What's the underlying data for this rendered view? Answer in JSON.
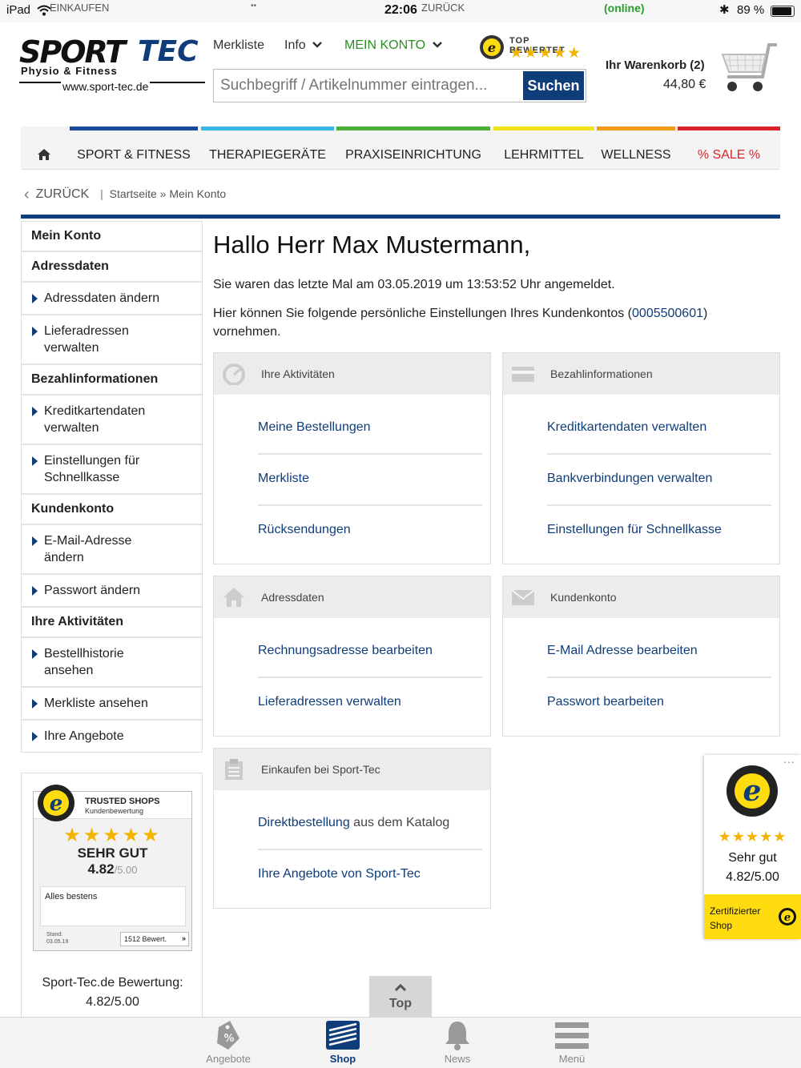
{
  "statusbar": {
    "device": "iPad",
    "back_app": "EINKAUFEN",
    "dots": "••",
    "time": "22:06",
    "back_label": "ZURÜCK",
    "online": "(online)",
    "battery": "89 %"
  },
  "header": {
    "logo_line1": "SPORT",
    "logo_line1b": "TEC",
    "logo_sub": "Physio & Fitness",
    "logo_url": "www.sport-tec.de",
    "merkliste": "Merkliste",
    "info": "Info",
    "mein_konto": "MEIN KONTO",
    "top_bewertet": "TOP BEWERTET",
    "search_placeholder": "Suchbegriff / Artikelnummer eintragen...",
    "search_button": "Suchen",
    "cart_label": "Ihr Warenkorb (2)",
    "cart_total": "44,80 €"
  },
  "nav": {
    "items": [
      {
        "label": "SPORT & FITNESS",
        "color": "#1a4a9c"
      },
      {
        "label": "THERAPIEGERÄTE",
        "color": "#39b6e6"
      },
      {
        "label": "PRAXISEINRICHTUNG",
        "color": "#4caf37"
      },
      {
        "label": "LEHRMITTEL",
        "color": "#f2e21a"
      },
      {
        "label": "WELLNESS",
        "color": "#f39a16"
      },
      {
        "label": "% SALE %",
        "color": "#d9232a"
      }
    ]
  },
  "breadcrumb": {
    "back": "ZURÜCK",
    "path": "Startseite » Mein Konto"
  },
  "sidebar": {
    "title": "Mein Konto",
    "sections": [
      {
        "head": "Adressdaten",
        "items": [
          "Adressdaten ändern",
          "Lieferadressen verwalten"
        ]
      },
      {
        "head": "Bezahlinformationen",
        "items": [
          "Kreditkartendaten verwalten",
          "Einstellungen für Schnellkasse"
        ]
      },
      {
        "head": "Kundenkonto",
        "items": [
          "E-Mail-Adresse ändern",
          "Passwort ändern"
        ]
      },
      {
        "head": "Ihre Aktivitäten",
        "items": [
          "Bestellhistorie ansehen",
          "Merkliste ansehen",
          "Ihre Angebote"
        ]
      }
    ]
  },
  "trusted_left": {
    "brand": "TRUSTED SHOPS",
    "sub": "Kundenbewertung",
    "stars": "★★★★★",
    "rating_text": "SEHR GUT",
    "score": "4.82",
    "score_max": "/5.00",
    "comment": "Alles bestens",
    "stand_label": "Stand:",
    "stand_date": "03.05.19",
    "count": "1512 Bewert.",
    "bewertung_line1": "Sport-Tec.de Bewertung:",
    "bewertung_line2": "4.82/5.00"
  },
  "main": {
    "greeting": "Hallo Herr Max Mustermann,",
    "last_login": "Sie waren das letzte Mal am 03.05.2019 um 13:53:52 Uhr angemeldet.",
    "intro_a": "Hier können Sie folgende persönliche Einstellungen Ihres Kundenkontos (",
    "account_no": "0005500601",
    "intro_b": ")",
    "intro_c": "vornehmen."
  },
  "cards": {
    "activities": {
      "title": "Ihre Aktivitäten",
      "links": [
        "Meine Bestellungen",
        "Merkliste",
        "Rücksendungen"
      ]
    },
    "payment": {
      "title": "Bezahlinformationen",
      "links": [
        "Kreditkartendaten verwalten",
        "Bankverbindungen verwalten",
        "Einstellungen für Schnellkasse"
      ]
    },
    "address": {
      "title": "Adressdaten",
      "links": [
        "Rechnungsadresse bearbeiten",
        "Lieferadressen verwalten"
      ]
    },
    "account": {
      "title": "Kundenkonto",
      "links": [
        "E-Mail Adresse bearbeiten",
        "Passwort bearbeiten"
      ]
    },
    "shopping": {
      "title": "Einkaufen bei Sport-Tec",
      "link1": "Direktbestellung",
      "link1_rest": " aus dem Katalog",
      "link2": "Ihre Angebote von Sport-Tec"
    }
  },
  "trusted_right": {
    "more": "···",
    "stars": "★★★★★",
    "rating": "Sehr gut",
    "score": "4.82/5.00",
    "certified_line1": "Zertifizierter",
    "certified_line2": "Shop"
  },
  "top_button": {
    "label": "Top"
  },
  "tabbar": {
    "tabs": [
      {
        "label": "Angebote",
        "active": false
      },
      {
        "label": "Shop",
        "active": true
      },
      {
        "label": "News",
        "active": false
      },
      {
        "label": "Menü",
        "active": false
      }
    ]
  },
  "colors": {
    "brand": "#0f3d7a",
    "online": "#2a9d2a",
    "trusted_yellow": "#ffdc0f"
  }
}
